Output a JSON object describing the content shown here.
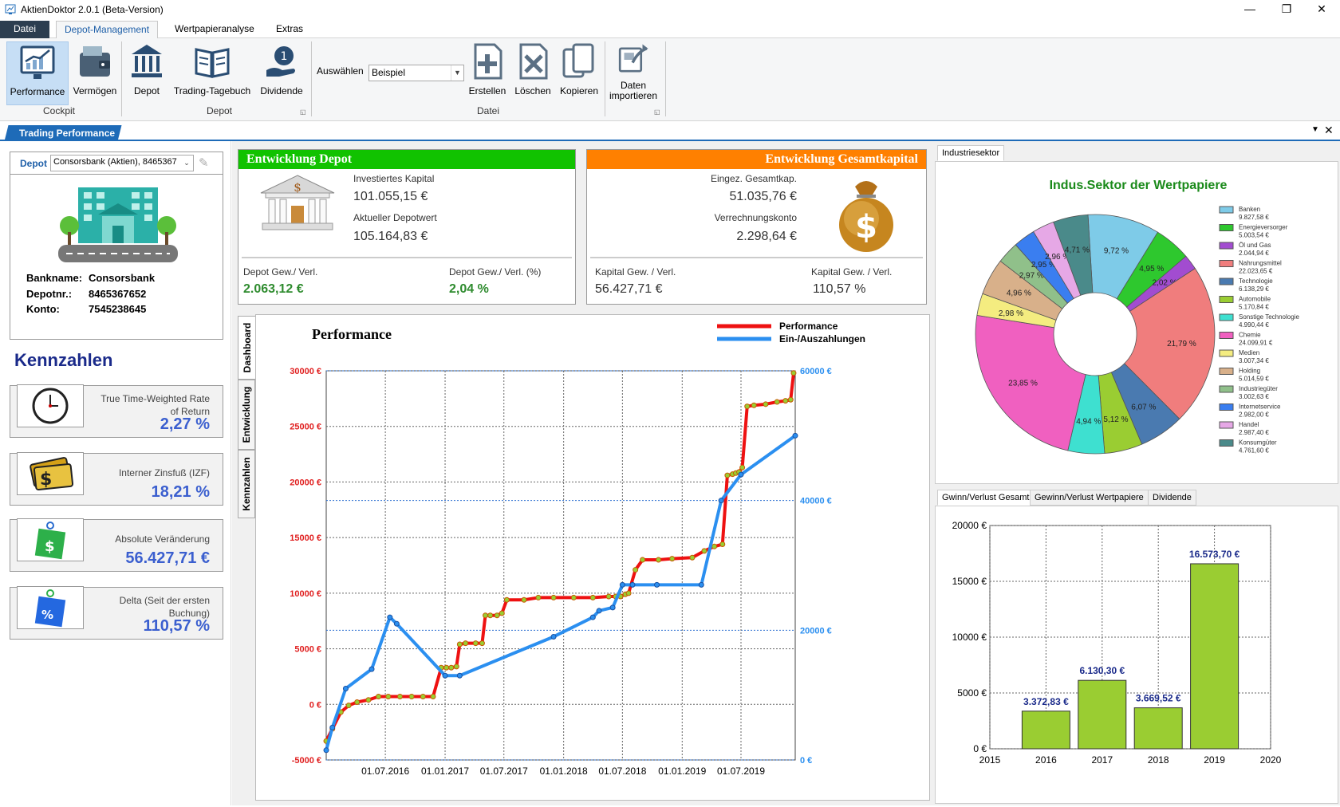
{
  "window": {
    "title": "AktienDoktor 2.0.1 (Beta-Version)",
    "minimize": "—",
    "maximize": "❐",
    "close": "✕"
  },
  "menu": {
    "tabs": [
      "Datei",
      "Depot-Management",
      "Wertpapieranalyse",
      "Extras"
    ],
    "active": "Depot-Management"
  },
  "ribbon": {
    "cockpit": {
      "group_label": "Cockpit",
      "performance": "Performance",
      "vermoegen": "Vermögen"
    },
    "depot": {
      "group_label": "Depot",
      "depot": "Depot",
      "trading_tagebuch": "Trading-Tagebuch",
      "dividende": "Dividende"
    },
    "datei": {
      "group_label": "Datei",
      "auswaehlen_label": "Auswählen",
      "auswaehlen_value": "Beispiel",
      "erstellen": "Erstellen",
      "loeschen": "Löschen",
      "kopieren": "Kopieren"
    },
    "import": {
      "label_line1": "Daten",
      "label_line2": "importieren"
    }
  },
  "doc_tab": {
    "label": "Trading Performance"
  },
  "depot_panel": {
    "depot_label": "Depot",
    "depot_value": "Consorsbank (Aktien), 8465367",
    "bankname_label": "Bankname:",
    "bankname": "Consorsbank",
    "depotnr_label": "Depotnr.:",
    "depotnr": "8465367652",
    "konto_label": "Konto:",
    "konto": "7545238645"
  },
  "kennzahlen": {
    "title": "Kennzahlen",
    "items": [
      {
        "label_line1": "True Time-Weighted Rate",
        "label_line2": "of Return",
        "value": "2,27 %"
      },
      {
        "label_line1": "Interner Zinsfuß (IZF)",
        "label_line2": "",
        "value": "18,21 %"
      },
      {
        "label_line1": "Absolute Veränderung",
        "label_line2": "",
        "value": "56.427,71 €"
      },
      {
        "label_line1": "Delta (Seit der ersten",
        "label_line2": "Buchung)",
        "value": "110,57 %"
      }
    ]
  },
  "entwicklung_depot": {
    "title": "Entwicklung Depot",
    "investiert_label": "Investiertes Kapital",
    "investiert": "101.055,15 €",
    "aktuell_label": "Aktueller Depotwert",
    "aktuell": "105.164,83 €",
    "gv_label": "Depot Gew./ Verl.",
    "gv": "2.063,12 €",
    "gvp_label": "Depot Gew./ Verl. (%)",
    "gvp": "2,04 %",
    "color": "#11c200"
  },
  "entwicklung_gesamt": {
    "title": "Entwicklung Gesamtkapital",
    "eingez_label": "Eingez. Gesamtkap.",
    "eingez": "51.035,76 €",
    "verrechnung_label": "Verrechnungskonto",
    "verrechnung": "2.298,64 €",
    "kgv_label": "Kapital Gew. / Verl.",
    "kgv": "56.427,71 €",
    "kgvp_label": "Kapital Gew. / Verl.",
    "kgvp": "110,57 %",
    "color": "#ff8000"
  },
  "side_tabs": [
    "Dashboard",
    "Entwicklung",
    "Kennzahlen"
  ],
  "pie_tab": "Industriesektor",
  "bar_tabs": [
    "Gwinn/Verlust Gesamt",
    "Gewinn/Verlust Wertpapiere",
    "Dividende"
  ],
  "chart_data": [
    {
      "type": "line",
      "title": "Performance",
      "y_left_ticks": [
        "30000 €",
        "25000 €",
        "20000 €",
        "15000 €",
        "10000 €",
        "5000 €",
        "0 €",
        "-5000 €"
      ],
      "y_right_ticks": [
        "60000 €",
        "40000 €",
        "20000 €",
        "0 €"
      ],
      "x_ticks": [
        "01.07.2016",
        "01.01.2017",
        "01.07.2017",
        "01.01.2018",
        "01.07.2018",
        "01.01.2019",
        "01.07.2019"
      ],
      "ylim_left": [
        -5000,
        30000
      ],
      "ylim_right": [
        0,
        60000
      ],
      "xlim": [
        "2016-01-01",
        "2019-12-15"
      ],
      "series": [
        {
          "name": "Performance",
          "axis": "left",
          "color": "#ee1111",
          "x": [
            "2016-01-01",
            "2016-01-20",
            "2016-02-15",
            "2016-03-10",
            "2016-04-05",
            "2016-05-10",
            "2016-06-10",
            "2016-07-10",
            "2016-08-15",
            "2016-09-20",
            "2016-10-25",
            "2016-11-25",
            "2016-12-20",
            "2017-01-05",
            "2017-01-20",
            "2017-02-05",
            "2017-02-15",
            "2017-03-05",
            "2017-04-05",
            "2017-04-25",
            "2017-05-05",
            "2017-05-20",
            "2017-06-10",
            "2017-06-25",
            "2017-07-10",
            "2017-09-01",
            "2017-10-15",
            "2017-12-01",
            "2018-02-01",
            "2018-04-01",
            "2018-05-20",
            "2018-06-10",
            "2018-06-25",
            "2018-07-10",
            "2018-07-20",
            "2018-08-10",
            "2018-09-01",
            "2018-10-20",
            "2018-12-01",
            "2019-02-01",
            "2019-03-10",
            "2019-04-10",
            "2019-05-05",
            "2019-05-20",
            "2019-06-05",
            "2019-06-15",
            "2019-06-25",
            "2019-07-05",
            "2019-07-20",
            "2019-08-10",
            "2019-09-15",
            "2019-10-20",
            "2019-11-15",
            "2019-12-01",
            "2019-12-10"
          ],
          "y": [
            -3300,
            -2200,
            -700,
            -100,
            200,
            400,
            700,
            700,
            700,
            700,
            700,
            700,
            3300,
            3300,
            3300,
            3400,
            5400,
            5500,
            5500,
            5500,
            8000,
            8000,
            8000,
            8200,
            9400,
            9400,
            9600,
            9600,
            9600,
            9600,
            9700,
            9700,
            9700,
            9900,
            10000,
            12100,
            13000,
            13000,
            13100,
            13200,
            13800,
            14200,
            14400,
            20600,
            20700,
            20800,
            20900,
            21300,
            26800,
            26900,
            27000,
            27200,
            27300,
            27400,
            29800
          ]
        },
        {
          "name": "Ein-/Auszahlungen",
          "axis": "right",
          "color": "#2b8ff0",
          "x": [
            "2016-01-01",
            "2016-01-20",
            "2016-03-01",
            "2016-05-20",
            "2016-07-15",
            "2016-08-05",
            "2017-01-01",
            "2017-02-15",
            "2017-12-01",
            "2018-04-01",
            "2018-04-20",
            "2018-06-01",
            "2018-07-01",
            "2018-08-01",
            "2018-10-15",
            "2019-03-01",
            "2019-05-01",
            "2019-07-01",
            "2019-12-15"
          ],
          "y": [
            1500,
            5000,
            11000,
            14000,
            22000,
            21000,
            13000,
            13000,
            19000,
            22000,
            23000,
            23500,
            27000,
            27000,
            27000,
            27000,
            40000,
            44000,
            50000
          ]
        }
      ]
    },
    {
      "type": "pie",
      "title": "Indus.Sektor der Wertpapiere",
      "slices": [
        {
          "label": "Banken",
          "value": 9827.58,
          "value_text": "9.827,58 €",
          "pct": "9,72 %",
          "color": "#7ecbe8"
        },
        {
          "label": "Energieversorger",
          "value": 5003.54,
          "value_text": "5.003,54 €",
          "pct": "4,95 %",
          "color": "#2ec82e"
        },
        {
          "label": "Öl und Gas",
          "value": 2044.94,
          "value_text": "2.044,94 €",
          "pct": "2,02 %",
          "color": "#a24cd0"
        },
        {
          "label": "Nahrungsmittel",
          "value": 22023.65,
          "value_text": "22.023,65 €",
          "pct": "21,79 %",
          "color": "#f07d7d"
        },
        {
          "label": "Technologie",
          "value": 6138.29,
          "value_text": "6.138,29 €",
          "pct": "6,07 %",
          "color": "#4a7ab0"
        },
        {
          "label": "Automobile",
          "value": 5170.84,
          "value_text": "5.170,84 €",
          "pct": "5,12 %",
          "color": "#9acd32"
        },
        {
          "label": "Sonstige Technologie",
          "value": 4990.44,
          "value_text": "4.990,44 €",
          "pct": "4,94 %",
          "color": "#3ee0d0"
        },
        {
          "label": "Chemie",
          "value": 24099.91,
          "value_text": "24.099,91 €",
          "pct": "23,85 %",
          "color": "#f060c0"
        },
        {
          "label": "Medien",
          "value": 3007.34,
          "value_text": "3.007,34 €",
          "pct": "2,98 %",
          "color": "#f4ec80"
        },
        {
          "label": "Holding",
          "value": 5014.59,
          "value_text": "5.014,59 €",
          "pct": "4,96 %",
          "color": "#d8b08a"
        },
        {
          "label": "Industriegüter",
          "value": 3002.63,
          "value_text": "3.002,63 €",
          "pct": "2,97 %",
          "color": "#90c08a"
        },
        {
          "label": "Internetservice",
          "value": 2982.0,
          "value_text": "2.982,00 €",
          "pct": "2,95 %",
          "color": "#3a7ef0"
        },
        {
          "label": "Handel",
          "value": 2987.4,
          "value_text": "2.987,40 €",
          "pct": "2,96 %",
          "color": "#e6a8e6"
        },
        {
          "label": "Konsumgüter",
          "value": 4761.6,
          "value_text": "4.761,60 €",
          "pct": "4,71 %",
          "color": "#4a8a8a"
        }
      ]
    },
    {
      "type": "bar",
      "categories": [
        "2016",
        "2017",
        "2018",
        "2019"
      ],
      "values": [
        3372.83,
        6130.3,
        3669.52,
        16573.7
      ],
      "value_labels": [
        "3.372,83 €",
        "6.130,30 €",
        "3.669,52 €",
        "16.573,70 €"
      ],
      "x_ticks": [
        "2015",
        "2016",
        "2017",
        "2018",
        "2019",
        "2020"
      ],
      "y_ticks": [
        "20000 €",
        "15000 €",
        "10000 €",
        "5000 €",
        "0 €"
      ],
      "ylim": [
        0,
        20000
      ],
      "color": "#9acd32",
      "label_color": "#1a2a8a"
    }
  ]
}
